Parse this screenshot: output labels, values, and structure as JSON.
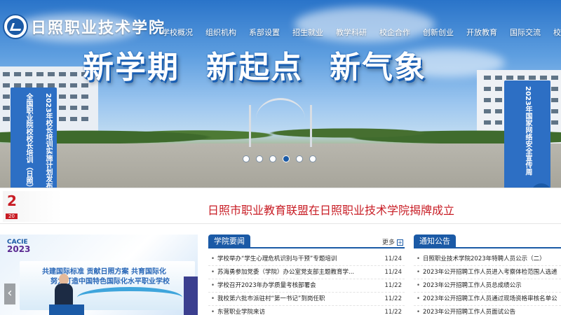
{
  "header": {
    "logo_text": "日照职业技术学院",
    "nav": [
      "学校概况",
      "组织机构",
      "系部设置",
      "招生就业",
      "教学科研",
      "校企合作",
      "创新创业",
      "开放教育",
      "国际交流",
      "校园"
    ]
  },
  "hero": {
    "slogan": [
      "新学期",
      "新起点",
      "新气象"
    ],
    "slide_count": 6,
    "active_slide": 4
  },
  "floats": {
    "left_line1": "2023年校长培训实施计划发布",
    "left_line2": "全国职业院校校长培训（日照）基地",
    "right_line1": "2023年国家网络安全宣传周",
    "scroll_top_icon": "↑",
    "close_glyph": "×"
  },
  "headline": {
    "tag_number": "2",
    "tag_year": "20",
    "text": "日照市职业教育联盟在日照职业技术学院揭牌成立"
  },
  "photo": {
    "cacie_label": "CACIE",
    "cacie_year": "2023",
    "board_line1": "共建国际标准  贡献日照方案  共育国际化",
    "board_line2": "努力打造中国特色国际化水平职业学校",
    "prev_icon": "‹"
  },
  "news": {
    "title": "学院要闻",
    "more": "更多",
    "more_icon": "+",
    "items": [
      {
        "title": "学校举办“学生心理危机识别与干预”专题培训",
        "date": "11/24"
      },
      {
        "title": "苏海勇参加党委（学院）办公室党支部主题教育学...",
        "date": "11/24"
      },
      {
        "title": "学校召开2023年办学质量考核部署会",
        "date": "11/22"
      },
      {
        "title": "我校第六批市派驻村“第一书记”到岗任职",
        "date": "11/22"
      },
      {
        "title": "东营职业学院来访",
        "date": "11/22"
      }
    ]
  },
  "notice": {
    "title": "通知公告",
    "items": [
      "日照职业技术学院2023年特聘人员公示（二）",
      "2023年公开招聘工作人员进入考察体检范围人选递",
      "2023年公开招聘工作人员总成绩公示",
      "2023年公开招聘工作人员通过现场资格审核名单公",
      "2023年公开招聘工作人员面试公告"
    ]
  },
  "colors": {
    "brand_blue": "#1b5aa6",
    "float_blue": "#2d6fc4",
    "headline_red": "#c81d25"
  }
}
